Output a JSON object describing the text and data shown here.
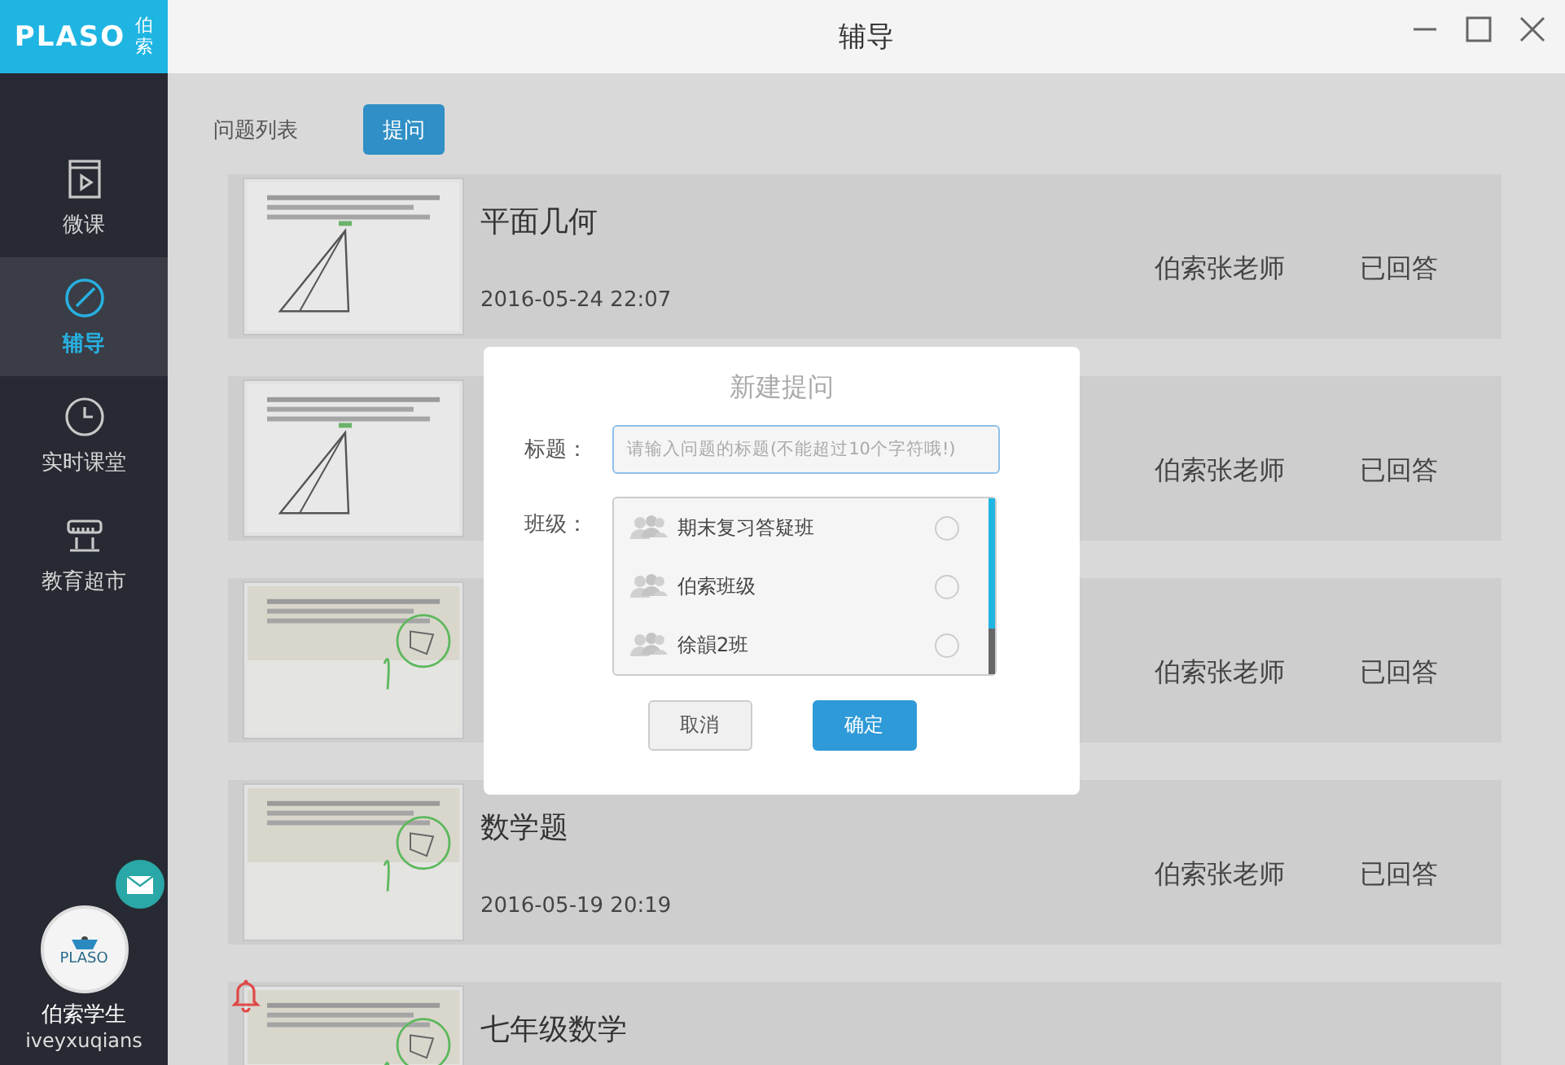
{
  "app": {
    "logo": "PLASO",
    "logo_cn": "伯索"
  },
  "window": {
    "title": "辅导"
  },
  "sidebar": {
    "items": [
      {
        "label": "微课",
        "kind": "video",
        "selected": false
      },
      {
        "label": "辅导",
        "kind": "pen",
        "selected": true
      },
      {
        "label": "实时课堂",
        "kind": "clock",
        "selected": false
      },
      {
        "label": "教育超市",
        "kind": "shop",
        "selected": false
      }
    ],
    "user": {
      "avatar_text": "PLASO",
      "name": "伯索学生",
      "id": "iveyxuqians",
      "has_message": true
    }
  },
  "toolbar": {
    "label": "问题列表",
    "ask_button": "提问"
  },
  "questions": [
    {
      "title": "平面几何",
      "date": "2016-05-24 22:07",
      "teacher": "伯索张老师",
      "status": "已回答",
      "alert": false
    },
    {
      "teacher": "伯索张老师",
      "status": "已回答",
      "alert": false
    },
    {
      "teacher": "伯索张老师",
      "status": "已回答",
      "alert": false
    },
    {
      "title": "数学题",
      "date": "2016-05-19 20:19",
      "teacher": "伯索张老师",
      "status": "已回答",
      "alert": false
    },
    {
      "title": "七年级数学",
      "alert": true
    }
  ],
  "dialog": {
    "title": "新建提问",
    "title_label": "标题：",
    "placeholder": "请输入问题的标题(不能超过10个字符哦!)",
    "class_label": "班级：",
    "classes": [
      {
        "name": "期末复习答疑班",
        "selected": false
      },
      {
        "name": "伯索班级",
        "selected": false
      },
      {
        "name": "徐韻2班",
        "selected": false
      }
    ],
    "cancel": "取消",
    "confirm": "确定"
  }
}
